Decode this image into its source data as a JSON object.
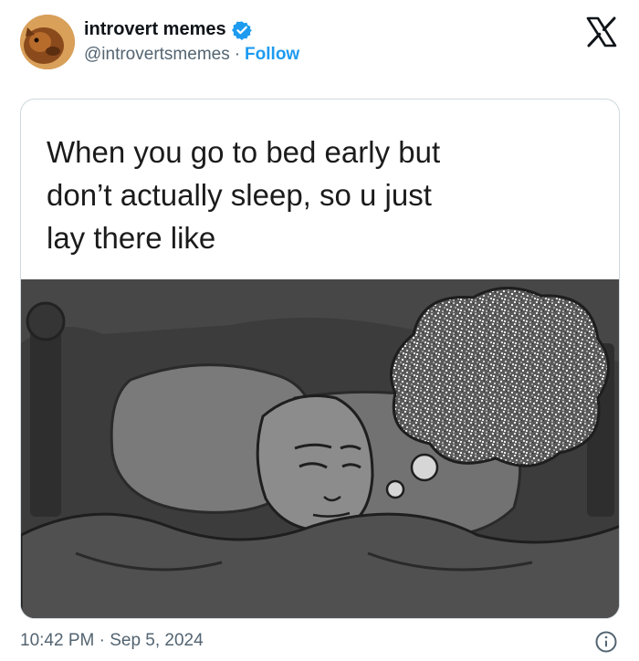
{
  "tweet": {
    "author_name": "introvert memes",
    "handle": "@introvertsmemes",
    "separator": "·",
    "follow_label": "Follow",
    "verified_icon": "verified-badge-icon",
    "platform_icon": "x-logo-icon"
  },
  "media": {
    "caption_lines": [
      "When you go to bed early but",
      "don’t actually sleep, so u just",
      "lay there like"
    ]
  },
  "footer": {
    "timestamp": "10:42 PM · Sep 5, 2024",
    "info_icon": "info-icon"
  },
  "colors": {
    "accent": "#1d9bf0",
    "muted_text": "#536471",
    "border": "#cfd9de"
  }
}
